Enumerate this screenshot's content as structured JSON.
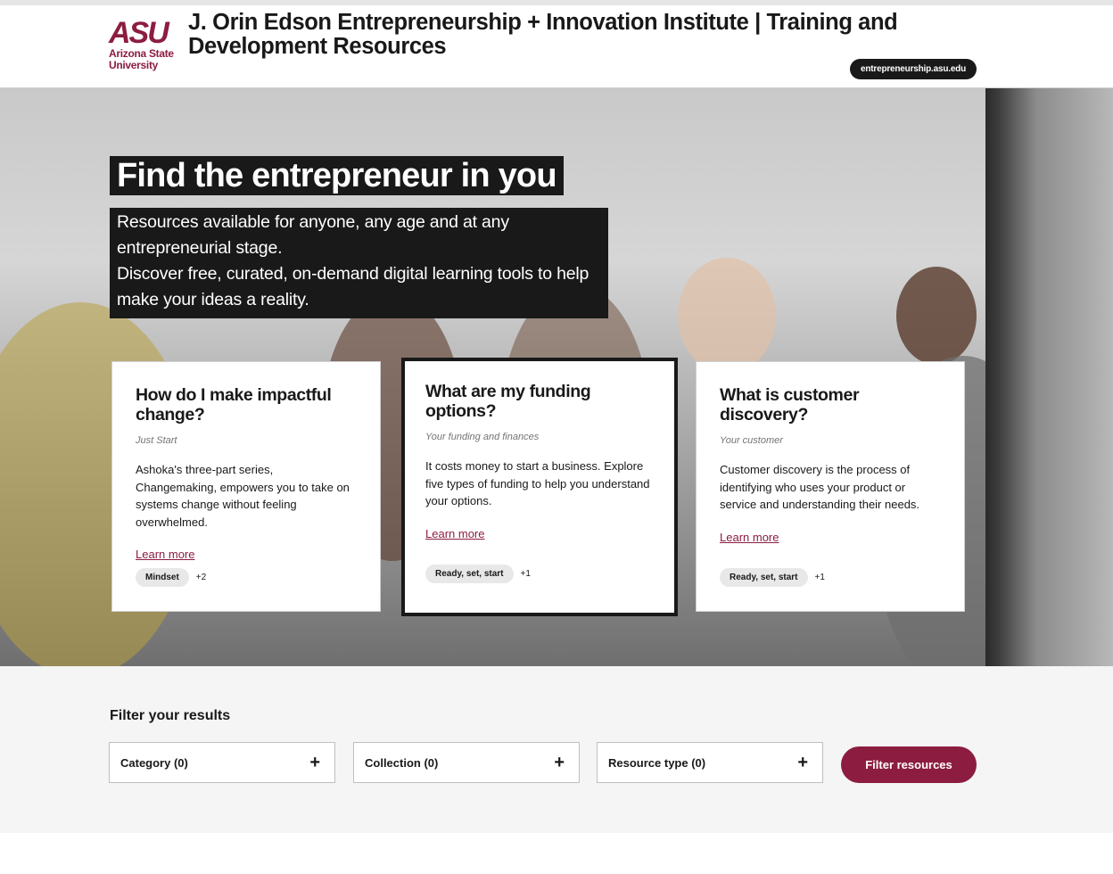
{
  "header": {
    "logo_mark": "ASU",
    "logo_sub_line1": "Arizona State",
    "logo_sub_line2": "University",
    "title": "J. Orin Edson Entrepreneurship + Innovation Institute | Training and Development Resources",
    "domain_pill": "entrepreneurship.asu.edu"
  },
  "hero": {
    "heading": "Find the entrepreneur in you",
    "text_line1": "Resources available for anyone, any age and at any entrepreneurial stage.",
    "text_line2": "Discover free, curated, on-demand digital learning tools to help make your ideas a reality."
  },
  "cards": [
    {
      "title": "How do I make impactful change?",
      "eyebrow": "Just Start",
      "body": "Ashoka's three-part series, Changemaking, empowers you to take on systems change without feeling overwhelmed.",
      "link": "Learn more",
      "tag": "Mindset",
      "more": "+2"
    },
    {
      "title": "What are my funding options?",
      "eyebrow": "Your funding and finances",
      "body": "It costs money to start a business. Explore five types of funding to help you understand your options.",
      "link": "Learn more",
      "tag": "Ready, set, start",
      "more": "+1"
    },
    {
      "title": "What is customer discovery?",
      "eyebrow": "Your customer",
      "body": "Customer discovery is the process of identifying who uses your product or service and understanding their needs.",
      "link": "Learn more",
      "tag": "Ready, set, start",
      "more": "+1"
    }
  ],
  "filters": {
    "heading": "Filter your results",
    "category_label": "Category  (0)",
    "collection_label": "Collection  (0)",
    "resource_type_label": "Resource type  (0)",
    "plus_icon": "+",
    "button": "Filter resources"
  },
  "colors": {
    "brand_maroon": "#8c1d40",
    "dark": "#191919"
  }
}
